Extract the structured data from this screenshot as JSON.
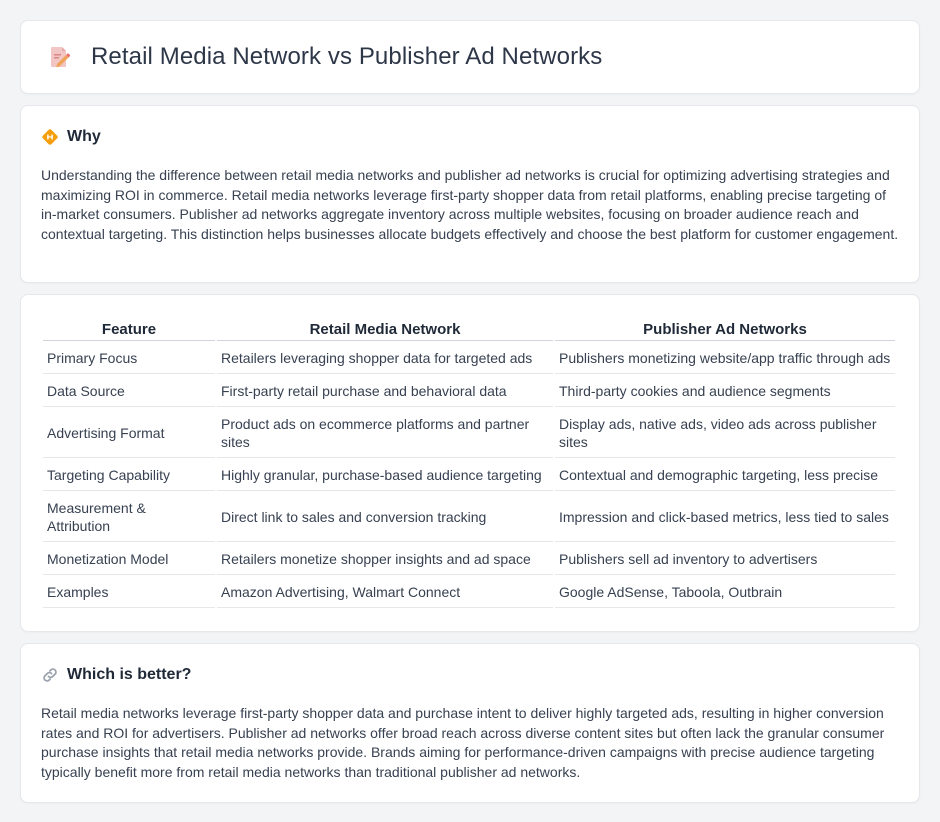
{
  "header": {
    "icon": "document-pencil-icon",
    "title": "Retail Media Network vs Publisher Ad Networks"
  },
  "why": {
    "icon": "diamond-sign-icon",
    "title": "Why",
    "text": "Understanding the difference between retail media networks and publisher ad networks is crucial for optimizing advertising strategies and maximizing ROI in commerce. Retail media networks leverage first-party shopper data from retail platforms, enabling precise targeting of in-market consumers. Publisher ad networks aggregate inventory across multiple websites, focusing on broader audience reach and contextual targeting. This distinction helps businesses allocate budgets effectively and choose the best platform for customer engagement."
  },
  "comparison": {
    "headers": [
      "Feature",
      "Retail Media Network",
      "Publisher Ad Networks"
    ],
    "rows": [
      [
        "Primary Focus",
        "Retailers leveraging shopper data for targeted ads",
        "Publishers monetizing website/app traffic through ads"
      ],
      [
        "Data Source",
        "First-party retail purchase and behavioral data",
        "Third-party cookies and audience segments"
      ],
      [
        "Advertising Format",
        "Product ads on ecommerce platforms and partner sites",
        "Display ads, native ads, video ads across publisher sites"
      ],
      [
        "Targeting Capability",
        "Highly granular, purchase-based audience targeting",
        "Contextual and demographic targeting, less precise"
      ],
      [
        "Measurement & Attribution",
        "Direct link to sales and conversion tracking",
        "Impression and click-based metrics, less tied to sales"
      ],
      [
        "Monetization Model",
        "Retailers monetize shopper insights and ad space",
        "Publishers sell ad inventory to advertisers"
      ],
      [
        "Examples",
        "Amazon Advertising, Walmart Connect",
        "Google AdSense, Taboola, Outbrain"
      ]
    ]
  },
  "better": {
    "icon": "link-icon",
    "title": "Which is better?",
    "text": "Retail media networks leverage first-party shopper data and purchase intent to deliver highly targeted ads, resulting in higher conversion rates and ROI for advertisers. Publisher ad networks offer broad reach across diverse content sites but often lack the granular consumer purchase insights that retail media networks provide. Brands aiming for performance-driven campaigns with precise audience targeting typically benefit more from retail media networks than traditional publisher ad networks."
  },
  "colors": {
    "background": "#f3f4f6",
    "card": "#ffffff",
    "border": "#e5e7eb",
    "heading": "#1f2937",
    "text": "#374151",
    "icon_orange": "#f59e0b",
    "icon_pink": "#e76f6f"
  }
}
